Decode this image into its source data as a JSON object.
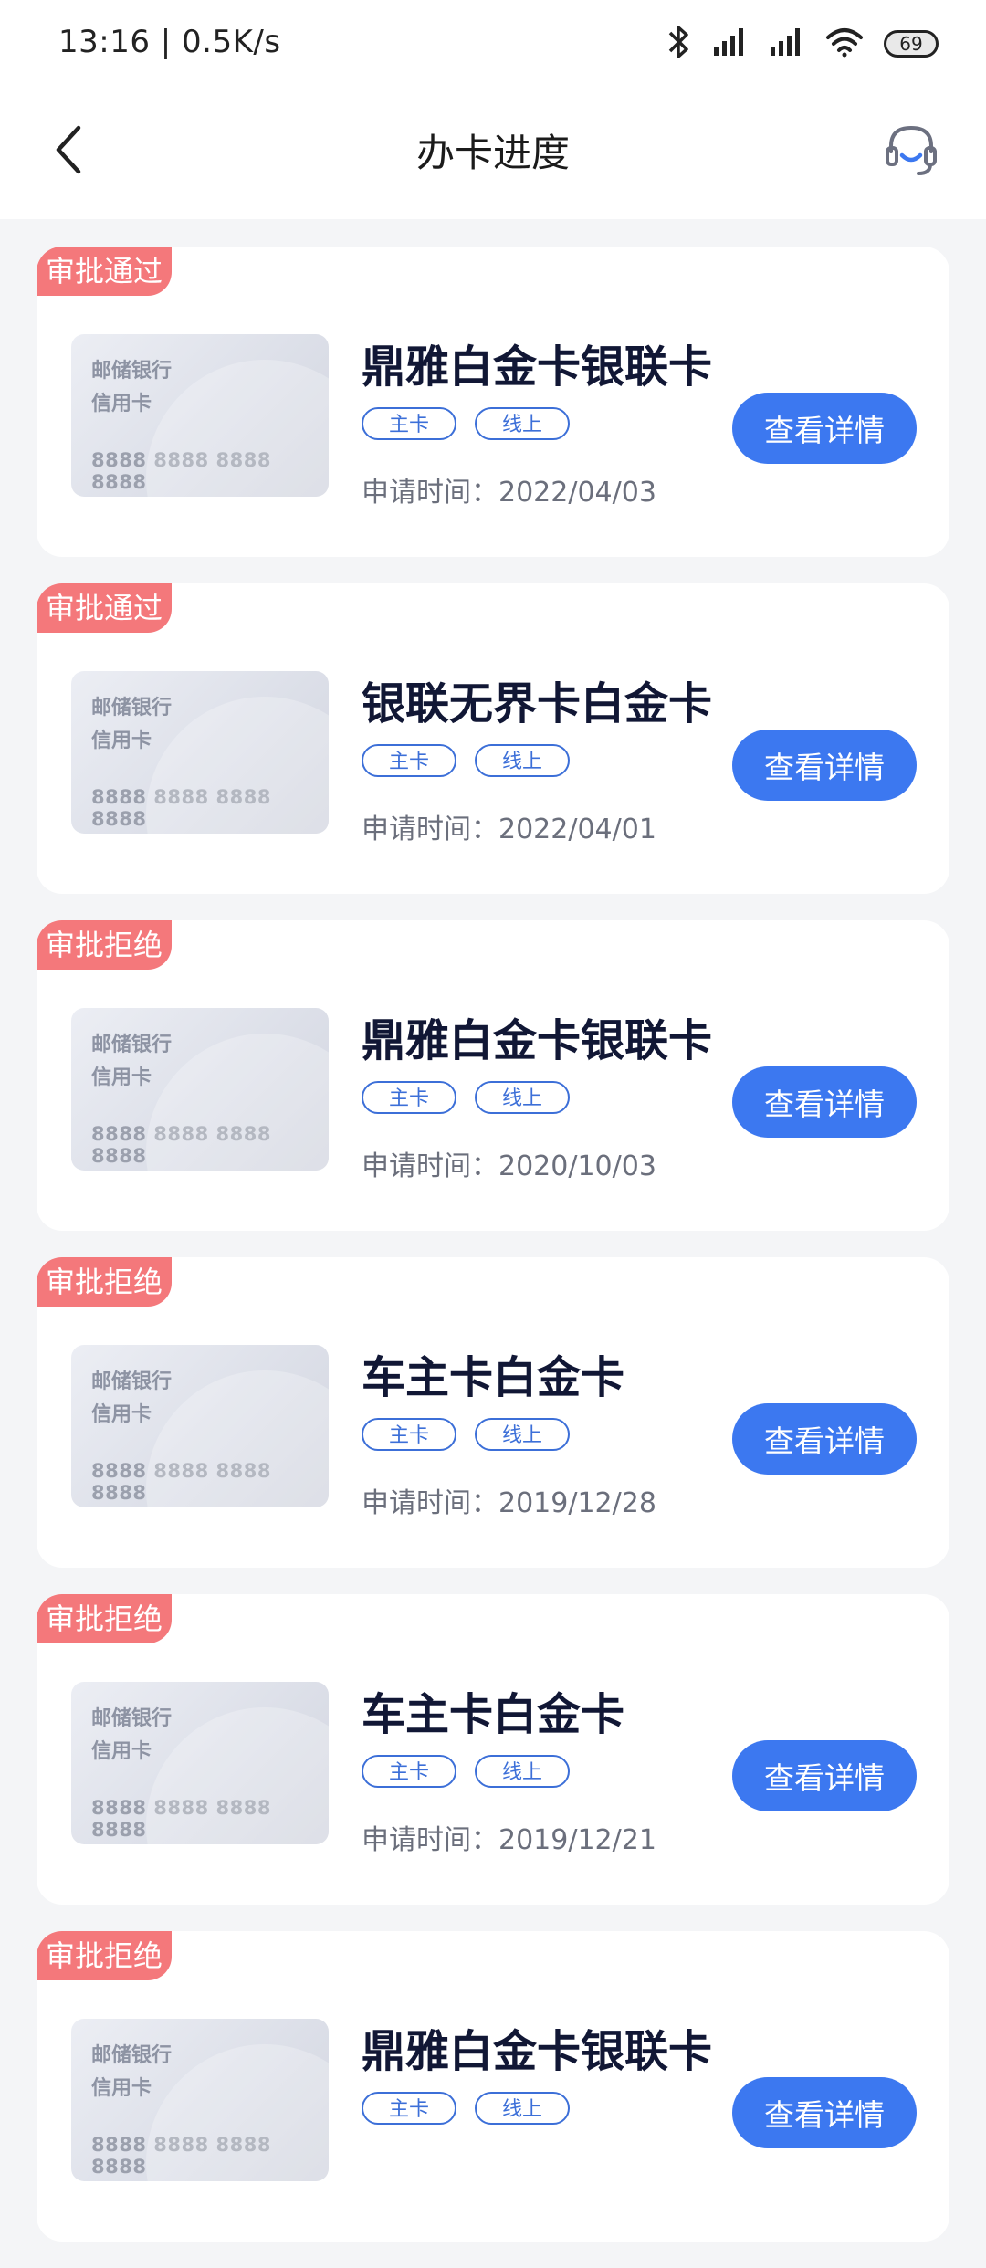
{
  "status_bar": {
    "time": "13:16 | 0.5K/s",
    "battery": "69",
    "icons": [
      "bluetooth-icon",
      "signal-icon",
      "signal-icon",
      "wifi-icon",
      "battery-icon"
    ]
  },
  "nav": {
    "title": "办卡进度",
    "back_icon": "chevron-left-icon",
    "service_icon": "headset-icon"
  },
  "colors": {
    "accent": "#3c78f0",
    "tag_border": "#3c6fd8",
    "status_tag": "#f4787b",
    "background": "#f4f5f7"
  },
  "card_image": {
    "bank": "邮储银行",
    "type": "信用卡",
    "number": "8888 8888 8888 8888"
  },
  "items": [
    {
      "status": "审批通过",
      "title": "鼎雅白金卡银联卡",
      "tags": [
        "主卡",
        "线上"
      ],
      "apply_time": "申请时间：2022/04/03",
      "button": "查看详情"
    },
    {
      "status": "审批通过",
      "title": "银联无界卡白金卡",
      "tags": [
        "主卡",
        "线上"
      ],
      "apply_time": "申请时间：2022/04/01",
      "button": "查看详情"
    },
    {
      "status": "审批拒绝",
      "title": "鼎雅白金卡银联卡",
      "tags": [
        "主卡",
        "线上"
      ],
      "apply_time": "申请时间：2020/10/03",
      "button": "查看详情"
    },
    {
      "status": "审批拒绝",
      "title": "车主卡白金卡",
      "tags": [
        "主卡",
        "线上"
      ],
      "apply_time": "申请时间：2019/12/28",
      "button": "查看详情"
    },
    {
      "status": "审批拒绝",
      "title": "车主卡白金卡",
      "tags": [
        "主卡",
        "线上"
      ],
      "apply_time": "申请时间：2019/12/21",
      "button": "查看详情"
    },
    {
      "status": "审批拒绝",
      "title": "鼎雅白金卡银联卡",
      "tags": [
        "主卡",
        "线上"
      ],
      "apply_time": "",
      "button": "查看详情"
    }
  ]
}
